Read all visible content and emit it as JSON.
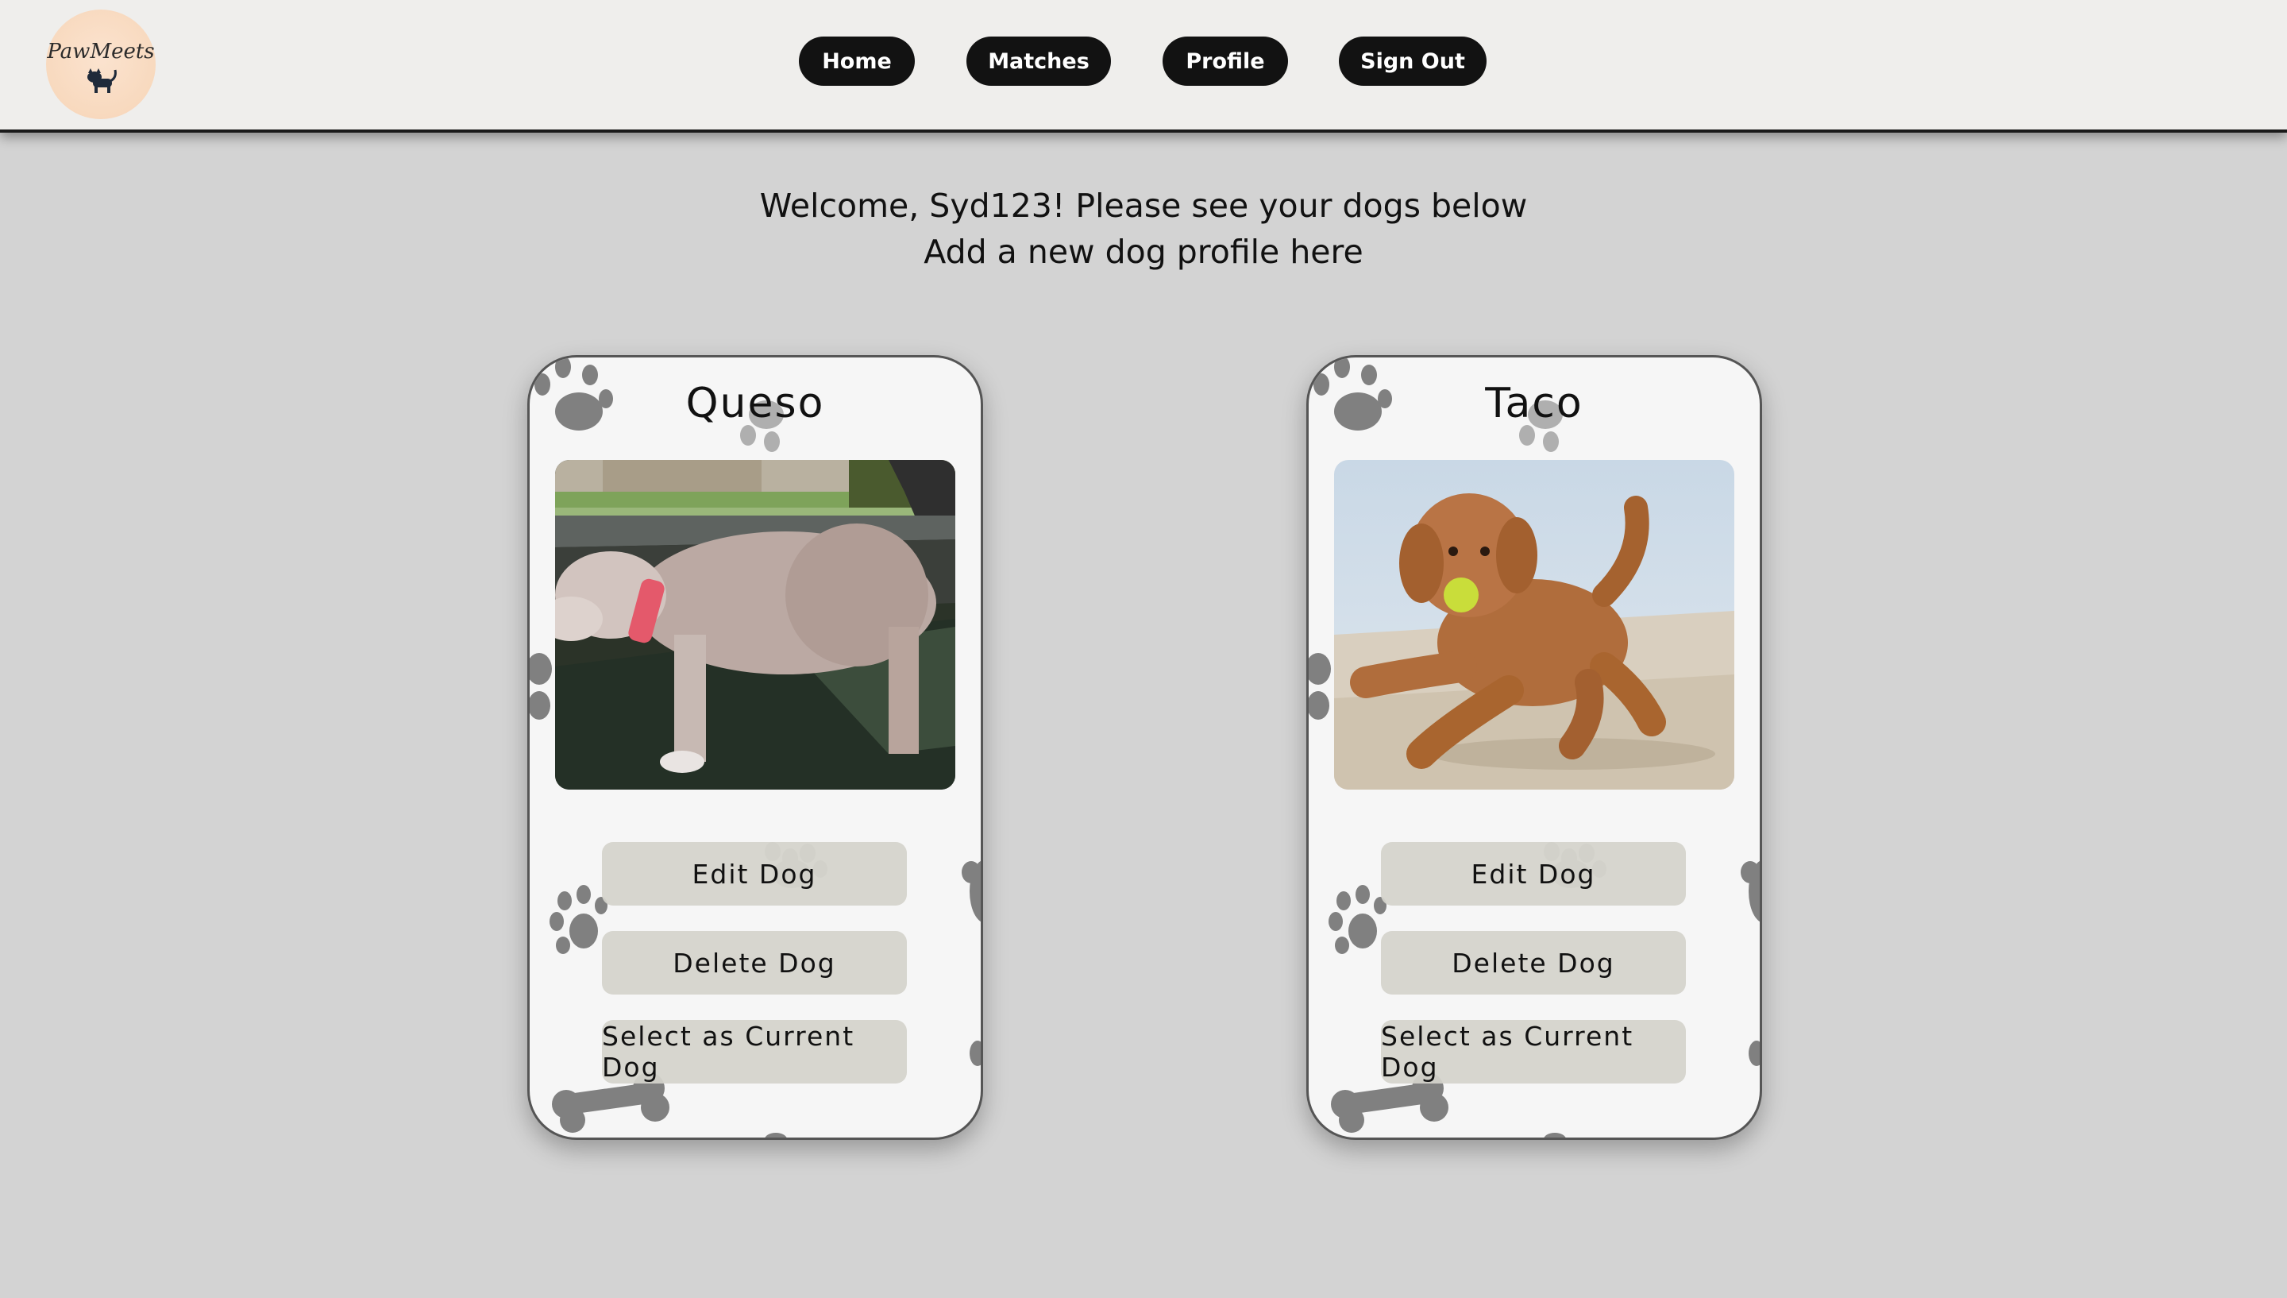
{
  "nav": {
    "logo_text": "PawMeets",
    "links": [
      "Home",
      "Matches",
      "Profile",
      "Sign Out"
    ]
  },
  "welcome": {
    "line1": "Welcome, Syd123! Please see your dogs below",
    "line2": "Add a new dog profile here"
  },
  "dogs": [
    {
      "name": "Queso",
      "buttons": [
        "Edit Dog",
        "Delete Dog",
        "Select as Current Dog"
      ]
    },
    {
      "name": "Taco",
      "buttons": [
        "Edit Dog",
        "Delete Dog",
        "Select as Current Dog"
      ]
    }
  ],
  "colors": {
    "page_bg": "#d3d3d3",
    "navbar_bg": "#efeeec",
    "nav_button_bg": "#121212",
    "card_bg": "#f6f6f6",
    "card_button_bg": "#d4d3cb",
    "paw_print": "#808080"
  }
}
